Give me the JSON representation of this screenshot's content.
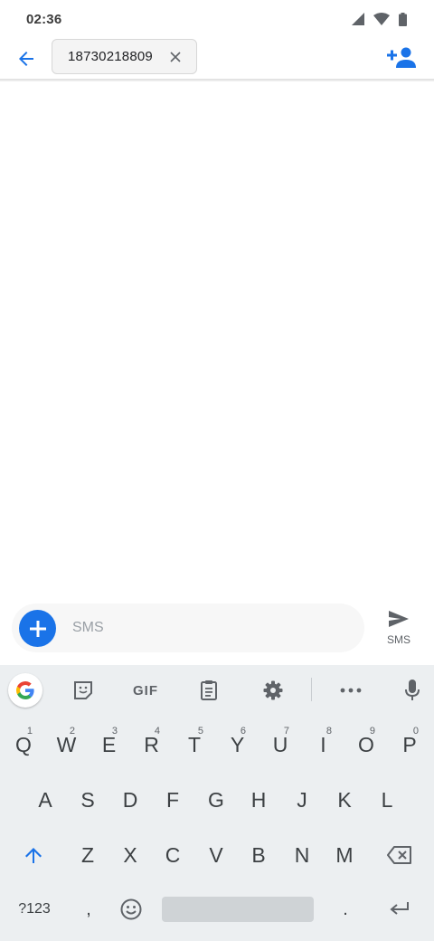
{
  "status_bar": {
    "time": "02:36",
    "icons": [
      "signal-icon",
      "wifi-icon",
      "battery-icon"
    ]
  },
  "app_bar": {
    "back_icon": "arrow-back-icon",
    "recipient": "18730218809",
    "chip_close_icon": "close-icon",
    "add_contact_icon": "person-add-icon"
  },
  "compose": {
    "attach_icon": "plus-icon",
    "placeholder": "SMS",
    "send_label": "SMS",
    "send_icon": "send-icon"
  },
  "keyboard": {
    "toolbar": [
      "google-icon",
      "sticker-icon",
      "gif-icon",
      "clipboard-icon",
      "settings-icon",
      "more-icon",
      "mic-icon"
    ],
    "gif_label": "GIF",
    "row1": [
      {
        "key": "Q",
        "hint": "1"
      },
      {
        "key": "W",
        "hint": "2"
      },
      {
        "key": "E",
        "hint": "3"
      },
      {
        "key": "R",
        "hint": "4"
      },
      {
        "key": "T",
        "hint": "5"
      },
      {
        "key": "Y",
        "hint": "6"
      },
      {
        "key": "U",
        "hint": "7"
      },
      {
        "key": "I",
        "hint": "8"
      },
      {
        "key": "O",
        "hint": "9"
      },
      {
        "key": "P",
        "hint": "0"
      }
    ],
    "row2": [
      "A",
      "S",
      "D",
      "F",
      "G",
      "H",
      "J",
      "K",
      "L"
    ],
    "row3": [
      "Z",
      "X",
      "C",
      "V",
      "B",
      "N",
      "M"
    ],
    "row4": {
      "symbols": "?123",
      "comma": ",",
      "period": "."
    },
    "accent": "#1a73e8"
  }
}
